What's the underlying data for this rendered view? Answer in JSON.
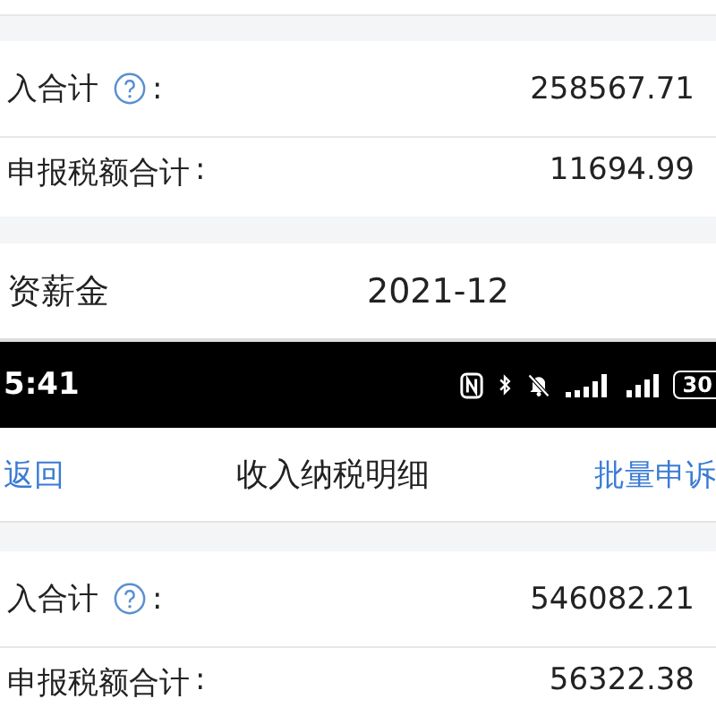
{
  "top_summary": {
    "rows": [
      {
        "label": "入合计",
        "help": true,
        "colon": ":",
        "value": "258567.71"
      },
      {
        "label": "申报税额合计",
        "help": false,
        "colon": ":",
        "value": "11694.99"
      }
    ]
  },
  "record": {
    "label": "资薪金",
    "date": "2021-12"
  },
  "status_bar": {
    "time": "5:41",
    "battery": "30"
  },
  "nav_bar": {
    "back": "返回",
    "title": "收入纳税明细",
    "action": "批量申诉"
  },
  "bottom_summary": {
    "rows": [
      {
        "label": "入合计",
        "help": true,
        "colon": ":",
        "value": "546082.21"
      },
      {
        "label": "申报税额合计",
        "help": false,
        "colon": ":",
        "value": "56322.38"
      }
    ]
  }
}
